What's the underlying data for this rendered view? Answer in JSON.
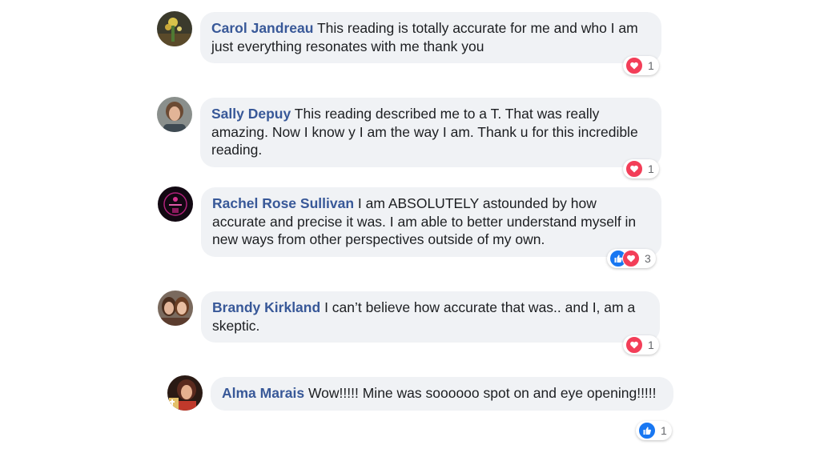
{
  "comments": [
    {
      "author": "Carol Jandreau",
      "text": "This reading is totally accurate for me and who I am just everything resonates with me thank you",
      "reactions": {
        "icons": [
          "love-icon"
        ],
        "count": "1"
      }
    },
    {
      "author": "Sally Depuy",
      "text": "This reading described me to a T. That was really amazing. Now I know y I am the way I am. Thank u for this incredible reading.",
      "reactions": {
        "icons": [
          "love-icon"
        ],
        "count": "1"
      }
    },
    {
      "author": "Rachel Rose Sullivan",
      "text": "I am ABSOLUTELY astounded by how accurate and precise it was. I am able to better understand myself in new ways from other perspectives outside of my own.",
      "reactions": {
        "icons": [
          "like-icon",
          "love-icon"
        ],
        "count": "3"
      }
    },
    {
      "author": "Brandy Kirkland",
      "text": "I can’t believe how accurate that was.. and I, am a skeptic.",
      "reactions": {
        "icons": [
          "love-icon"
        ],
        "count": "1"
      }
    },
    {
      "author": "Alma Marais",
      "text": "Wow!!!!! Mine was soooooo spot on and eye opening!!!!!",
      "reactions": {
        "icons": [
          "like-icon"
        ],
        "count": "1"
      }
    }
  ],
  "colors": {
    "bubble_bg": "#f0f2f5",
    "author_link": "#385898",
    "love": "#f33e58",
    "like": "#1877f2"
  }
}
